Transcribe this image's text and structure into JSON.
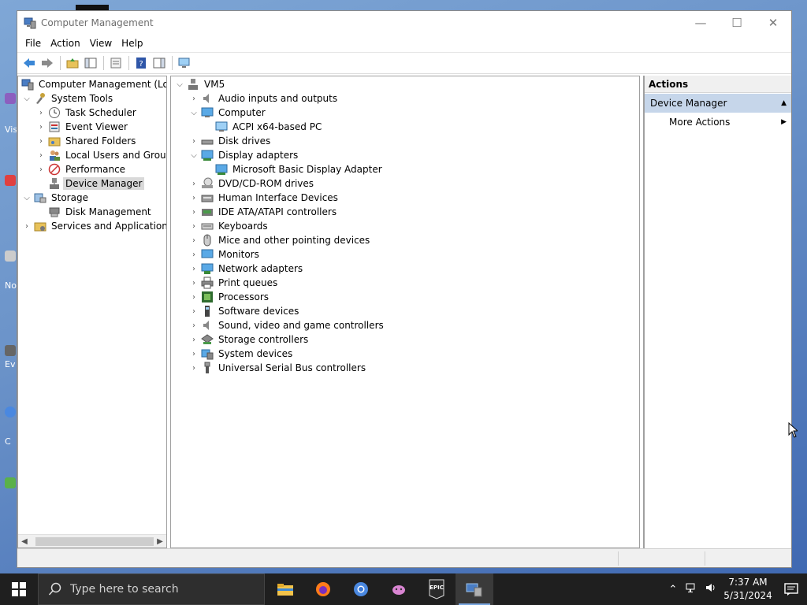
{
  "window": {
    "title": "Computer Management",
    "controls": {
      "minimize": "—",
      "maximize": "☐",
      "close": "✕"
    }
  },
  "menu": [
    "File",
    "Action",
    "View",
    "Help"
  ],
  "left_tree": {
    "root": "Computer Management (Local",
    "system_tools": "System Tools",
    "task_scheduler": "Task Scheduler",
    "event_viewer": "Event Viewer",
    "shared_folders": "Shared Folders",
    "local_users": "Local Users and Groups",
    "performance": "Performance",
    "device_manager": "Device Manager",
    "storage": "Storage",
    "disk_management": "Disk Management",
    "services": "Services and Applications"
  },
  "device_tree": {
    "root": "VM5",
    "items": [
      "Audio inputs and outputs",
      "Computer",
      "ACPI x64-based PC",
      "Disk drives",
      "Display adapters",
      "Microsoft Basic Display Adapter",
      "DVD/CD-ROM drives",
      "Human Interface Devices",
      "IDE ATA/ATAPI controllers",
      "Keyboards",
      "Mice and other pointing devices",
      "Monitors",
      "Network adapters",
      "Print queues",
      "Processors",
      "Software devices",
      "Sound, video and game controllers",
      "Storage controllers",
      "System devices",
      "Universal Serial Bus controllers"
    ]
  },
  "actions": {
    "header": "Actions",
    "section": "Device Manager",
    "more": "More Actions"
  },
  "taskbar": {
    "search_placeholder": "Type here to search",
    "time": "7:37 AM",
    "date": "5/31/2024"
  },
  "desktop_labels": [
    "Vis",
    "No",
    "Ev",
    "C"
  ],
  "colors": {
    "accent": "#c6d6ea",
    "taskbar": "#1f1f1f",
    "selection": "#d9d9d9"
  }
}
